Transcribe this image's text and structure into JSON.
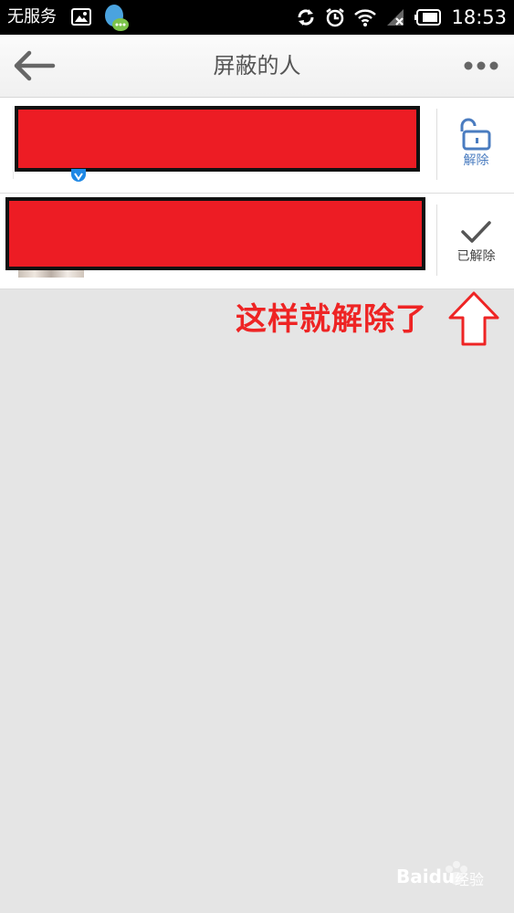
{
  "status_bar": {
    "carrier": "无服务",
    "time": "18:53"
  },
  "header": {
    "title": "屏蔽的人"
  },
  "blocked_list": {
    "items": [
      {
        "action_label": "解除",
        "action_icon": "unlock-icon"
      },
      {
        "action_label": "已解除",
        "action_icon": "checkmark-icon"
      }
    ]
  },
  "annotation": {
    "text": "这样就解除了"
  },
  "watermark": {
    "brand": "Baidu",
    "suffix": "经验"
  },
  "colors": {
    "redaction": "#ed1c24",
    "accent_blue": "#4a7cc0",
    "annotation_red": "#ee2424"
  }
}
